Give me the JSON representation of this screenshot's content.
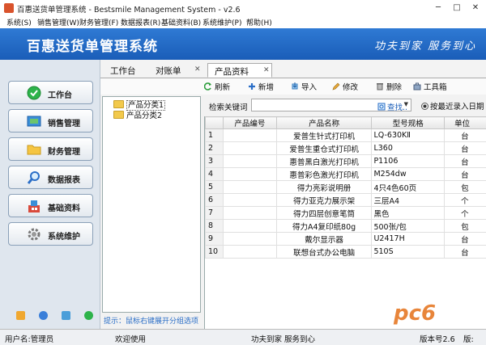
{
  "window": {
    "title": "百惠送货单管理系统 - Bestsmile Management System - v2.6",
    "minimize": "─",
    "maximize": "□",
    "close": "✕"
  },
  "menu": [
    "系统(S)",
    "销售管理(W)",
    "财务管理(F)",
    "数据报表(R)",
    "基础资料(B)",
    "系统维护(P)",
    "帮助(H)"
  ],
  "banner": {
    "title": "百惠送货单管理系统",
    "slogan": "功夫到家 服务到心"
  },
  "nav": [
    {
      "label": "工作台",
      "icon": "check-icon"
    },
    {
      "label": "销售管理",
      "icon": "sales-icon"
    },
    {
      "label": "财务管理",
      "icon": "folder-icon"
    },
    {
      "label": "数据报表",
      "icon": "search-icon"
    },
    {
      "label": "基础资料",
      "icon": "building-icon"
    },
    {
      "label": "系统维护",
      "icon": "gear-icon"
    }
  ],
  "tabs": [
    {
      "label": "工作台",
      "closable": false
    },
    {
      "label": "对账单",
      "closable": true
    },
    {
      "label": "产品资料",
      "closable": true
    }
  ],
  "toolbar": [
    {
      "label": "刷新",
      "icon": "refresh-icon"
    },
    {
      "label": "新增",
      "icon": "add-icon"
    },
    {
      "label": "导入",
      "icon": "import-icon"
    },
    {
      "label": "修改",
      "icon": "edit-icon"
    },
    {
      "label": "删除",
      "icon": "delete-icon"
    },
    {
      "label": "工具箱",
      "icon": "toolbox-icon"
    }
  ],
  "tree": {
    "nodes": [
      "产品分类1",
      "产品分类2"
    ],
    "hint": "提示：鼠标右键展开分组选项"
  },
  "search": {
    "label": "检索关键词",
    "value": "",
    "button": "查找..",
    "radio": "按最近录入日期"
  },
  "table": {
    "columns": [
      "",
      "产品编号",
      "产品名称",
      "型号规格",
      "单位"
    ],
    "rows": [
      [
        "1",
        "",
        "爱普生针式打印机",
        "LQ-630KⅡ",
        "台"
      ],
      [
        "2",
        "",
        "爱普生重仓式打印机",
        "L360",
        "台"
      ],
      [
        "3",
        "",
        "惠普黑白激光打印机",
        "P1106",
        "台"
      ],
      [
        "4",
        "",
        "惠普彩色激光打印机",
        "M254dw",
        "台"
      ],
      [
        "5",
        "",
        "得力亮彩说明册",
        "4只4色60页",
        "包"
      ],
      [
        "6",
        "",
        "得力亚克力展示架",
        "三层A4",
        "个"
      ],
      [
        "7",
        "",
        "得力四层创意笔筒",
        "黑色",
        "个"
      ],
      [
        "8",
        "",
        "得力A4复印纸80g",
        "500张/包",
        "包"
      ],
      [
        "9",
        "",
        "戴尔显示器",
        "U2417H",
        "台"
      ],
      [
        "10",
        "",
        "联想台式办公电脑",
        "510S",
        "台"
      ]
    ]
  },
  "status": {
    "user": "用户名:管理员",
    "welcome": "欢迎使用",
    "slogan": "功夫到家 服务到心",
    "version": "版本号2.6",
    "extra": "版:"
  },
  "watermark": "pc6"
}
